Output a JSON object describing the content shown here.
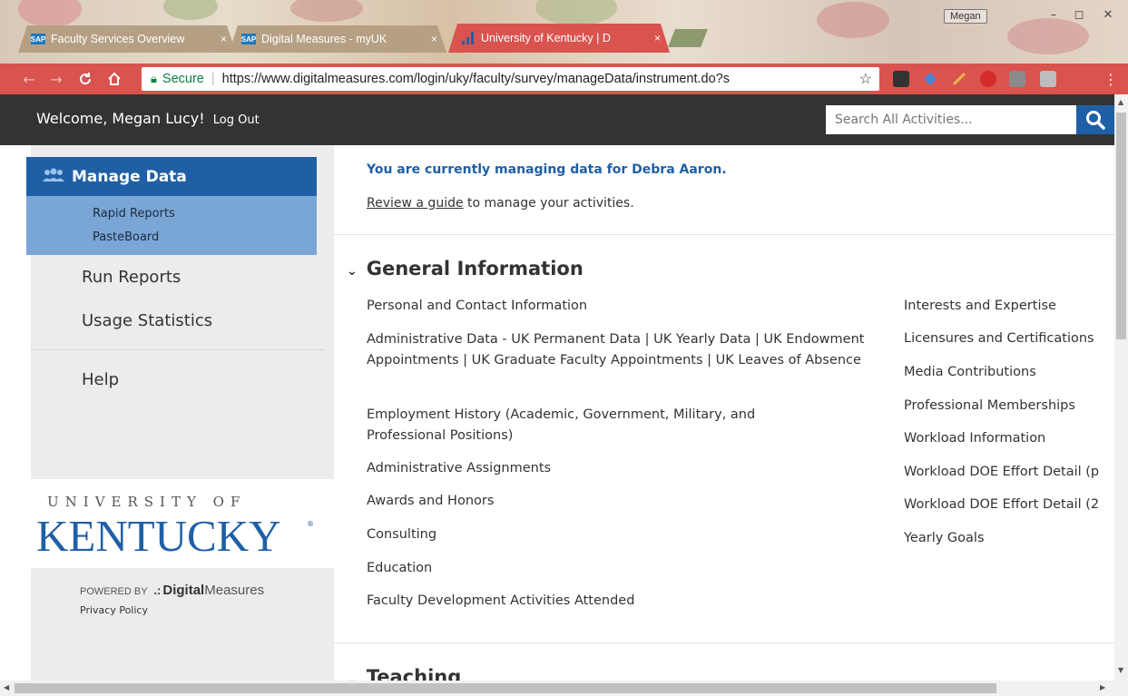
{
  "browser": {
    "tabs": [
      {
        "favicon": "SAP",
        "title": "Faculty Services Overview",
        "close": "×"
      },
      {
        "favicon": "SAP",
        "title": "Digital Measures - myUK",
        "close": "×"
      },
      {
        "favicon": "uk-favicon",
        "title": "University of Kentucky | D",
        "close": "×"
      }
    ],
    "profile_name": "Megan",
    "window_buttons": {
      "minimize": "–",
      "maximize": "◻",
      "close": "✕"
    },
    "secure_label": "Secure",
    "url": "https://www.digitalmeasures.com/login/uky/faculty/survey/manageData/instrument.do?s",
    "accent_color": "#d9534f"
  },
  "header": {
    "welcome": "Welcome, Megan Lucy!",
    "logout": "Log Out",
    "search_placeholder": "Search All Activities..."
  },
  "sidebar": {
    "manage_data": "Manage Data",
    "sub_items": [
      "Rapid Reports",
      "PasteBoard"
    ],
    "links": [
      "Run Reports",
      "Usage Statistics",
      "Help"
    ],
    "logo_line1": "UNIVERSITY OF",
    "logo_line2": "KENTUCKY",
    "powered_by": "POWERED BY",
    "dm_bold": "Digital",
    "dm_light": "Measures",
    "privacy": "Privacy Policy"
  },
  "main": {
    "notice": "You are currently managing data for Debra Aaron.",
    "guide_link": "Review a guide",
    "guide_rest": " to manage your activities.",
    "sections": [
      {
        "title": "General Information",
        "left_items": [
          "Personal and Contact Information",
          "Administrative Data - UK Permanent Data | UK Yearly Data | UK Endowment Appointments | UK Graduate Faculty Appointments | UK Leaves of Absence",
          "Employment History (Academic, Government, Military, and Professional Positions)",
          "Administrative Assignments",
          "Awards and Honors",
          "Consulting",
          "Education",
          "Faculty Development Activities Attended"
        ],
        "right_items": [
          "Interests and Expertise",
          "Licensures and Certifications",
          "Media Contributions",
          "Professional Memberships",
          "Workload Information",
          "Workload DOE Effort Detail (p",
          "Workload DOE Effort Detail (2",
          "Yearly Goals"
        ]
      },
      {
        "title": "Teaching"
      }
    ]
  }
}
